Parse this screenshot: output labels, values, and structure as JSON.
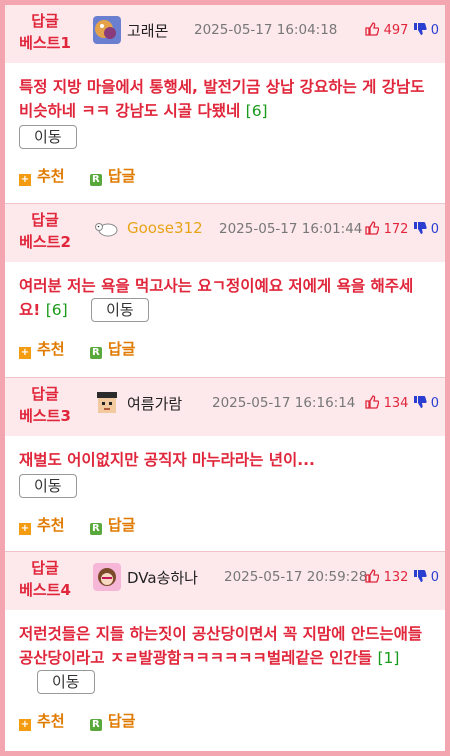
{
  "posts": [
    {
      "badge_line1": "답글",
      "badge_line2": "베스트1",
      "nickname": "고래몬",
      "nick_style": "normal",
      "avatar": "whale-avatar-icon",
      "date": "2025-05-17 16:04:18",
      "upvotes": "497",
      "downvotes": "0",
      "text": "특정 지방 마을에서 통행세, 발전기금 상납 강요하는 게 강남도 비슷하네 ㅋㅋ 강남도 시골 다됐네",
      "comment_count": "[6]",
      "button_label": "이동",
      "recommend_label": "추천",
      "reply_label": "답글"
    },
    {
      "badge_line1": "답글",
      "badge_line2": "베스트2",
      "nickname": "Goose312",
      "nick_style": "gold",
      "avatar": "sheep-avatar-icon",
      "date": "2025-05-17 16:01:44",
      "upvotes": "172",
      "downvotes": "0",
      "text": "여러분 저는 욕을 먹고사는 요ㄱ정이예요 저에게 욕을 해주세요!",
      "comment_count": "[6]",
      "button_label": "이동",
      "recommend_label": "추천",
      "reply_label": "답글"
    },
    {
      "badge_line1": "답글",
      "badge_line2": "베스트3",
      "nickname": "여름가람",
      "nick_style": "normal",
      "avatar": "pixel-face-avatar-icon",
      "date": "2025-05-17 16:16:14",
      "upvotes": "134",
      "downvotes": "0",
      "text": "재벌도 어이없지만 공직자 마누라라는 년이...",
      "comment_count": "",
      "button_label": "이동",
      "recommend_label": "추천",
      "reply_label": "답글"
    },
    {
      "badge_line1": "답글",
      "badge_line2": "베스트4",
      "nickname": "DVa송하나",
      "nick_style": "normal",
      "avatar": "dva-avatar-icon",
      "date": "2025-05-17 20:59:28",
      "upvotes": "132",
      "downvotes": "0",
      "text": "저런것들은 지들 하는짓이 공산당이면서 꼭 지맘에 안드는애들 공산당이라고 ㅈㄹ발광함ㅋㅋㅋㅋㅋㅋ벌레같은 인간들",
      "comment_count": "[1]",
      "button_label": "이동",
      "recommend_label": "추천",
      "reply_label": "답글"
    }
  ],
  "colors": {
    "accent": "#e0263b",
    "border": "#f4a6b0",
    "header_bg": "#fde9ec",
    "down": "#2a3fd1",
    "comment": "#1a9a1a"
  }
}
